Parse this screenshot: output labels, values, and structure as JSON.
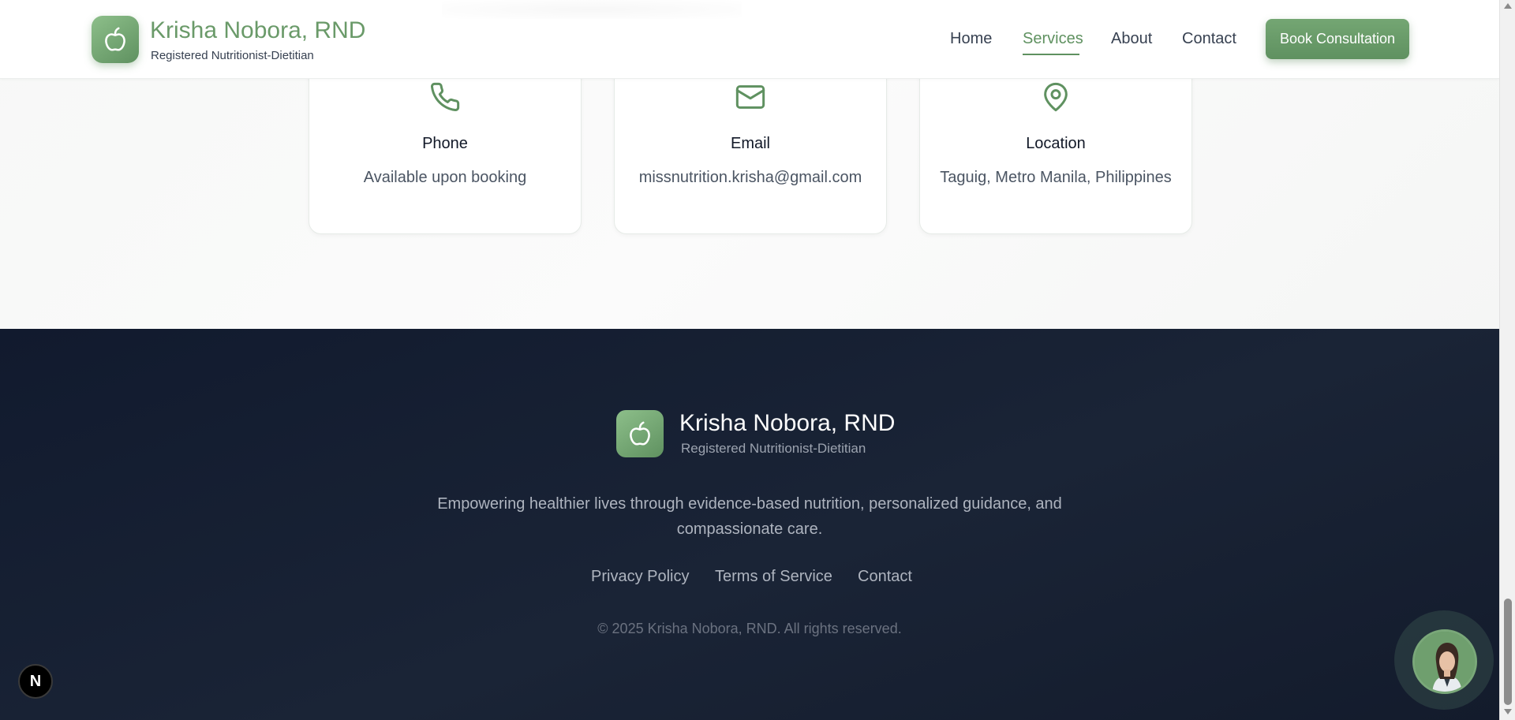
{
  "header": {
    "brand_name": "Krisha Nobora, RND",
    "brand_subtitle": "Registered Nutritionist-Dietitian",
    "nav": [
      {
        "label": "Home",
        "active": false
      },
      {
        "label": "Services",
        "active": true
      },
      {
        "label": "About",
        "active": false
      },
      {
        "label": "Contact",
        "active": false
      }
    ],
    "cta_label": "Book Consultation"
  },
  "contact_cards": [
    {
      "icon": "phone-icon",
      "title": "Phone",
      "value": "Available upon booking"
    },
    {
      "icon": "mail-icon",
      "title": "Email",
      "value": "missnutrition.krisha@gmail.com"
    },
    {
      "icon": "location-pin-icon",
      "title": "Location",
      "value": "Taguig, Metro Manila, Philippines"
    }
  ],
  "footer": {
    "brand_name": "Krisha Nobora, RND",
    "brand_subtitle": "Registered Nutritionist-Dietitian",
    "tagline": "Empowering healthier lives through evidence-based nutrition, personalized guidance, and compassionate care.",
    "links": [
      "Privacy Policy",
      "Terms of Service",
      "Contact"
    ],
    "copyright": "© 2025 Krisha Nobora, RND. All rights reserved."
  },
  "floating": {
    "next_badge_label": "N",
    "chat_icon": "assistant-avatar"
  },
  "colors": {
    "brand_green": "#5f9160",
    "footer_bg": "#1a2436",
    "text_dark": "#111827",
    "text_muted": "#4b5563"
  }
}
